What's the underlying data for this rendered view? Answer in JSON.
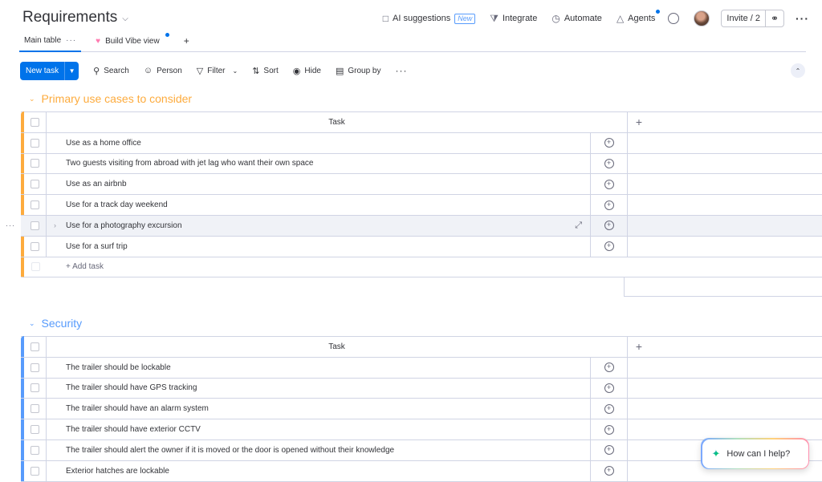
{
  "header": {
    "title": "Requirements",
    "actions": {
      "ai_suggestions": "AI suggestions",
      "new_badge": "New",
      "integrate": "Integrate",
      "automate": "Automate",
      "agents": "Agents",
      "invite": "Invite / 2"
    }
  },
  "tabs": [
    {
      "label": "Main table"
    },
    {
      "label": "Build Vibe view"
    }
  ],
  "toolbar": {
    "new_task": "New task",
    "search": "Search",
    "person": "Person",
    "filter": "Filter",
    "sort": "Sort",
    "hide": "Hide",
    "group_by": "Group by"
  },
  "groups": [
    {
      "title": "Primary use cases to consider",
      "color": "#fdab3d",
      "column_header": "Task",
      "items": [
        "Use as a home office",
        "Two guests visiting from abroad with jet lag who want their own space",
        "Use as an airbnb",
        "Use for a track day weekend",
        "Use for a photography excursion",
        "Use for a surf trip"
      ],
      "add_task": "+ Add task"
    },
    {
      "title": "Security",
      "color": "#579bfc",
      "column_header": "Task",
      "items": [
        "The trailer should be lockable",
        "The trailer should have GPS tracking",
        "The trailer should have an alarm system",
        "The trailer should have exterior CCTV",
        "The trailer should alert the owner if it is moved or the door is opened without their knowledge",
        "Exterior hatches are lockable"
      ]
    }
  ],
  "help": {
    "label": "How can I help?"
  },
  "icons": {
    "ai": "ai-suggestions-icon",
    "integrate": "integrate-icon",
    "automate": "automate-icon",
    "agents": "agents-icon",
    "chat": "chat-icon",
    "link": "link-icon",
    "search": "search-icon",
    "person": "person-icon",
    "filter": "filter-icon",
    "sort": "sort-icon",
    "hide": "eye-off-icon",
    "group_by": "group-by-icon",
    "update": "add-update-icon",
    "sparkle": "sparkle-icon"
  }
}
